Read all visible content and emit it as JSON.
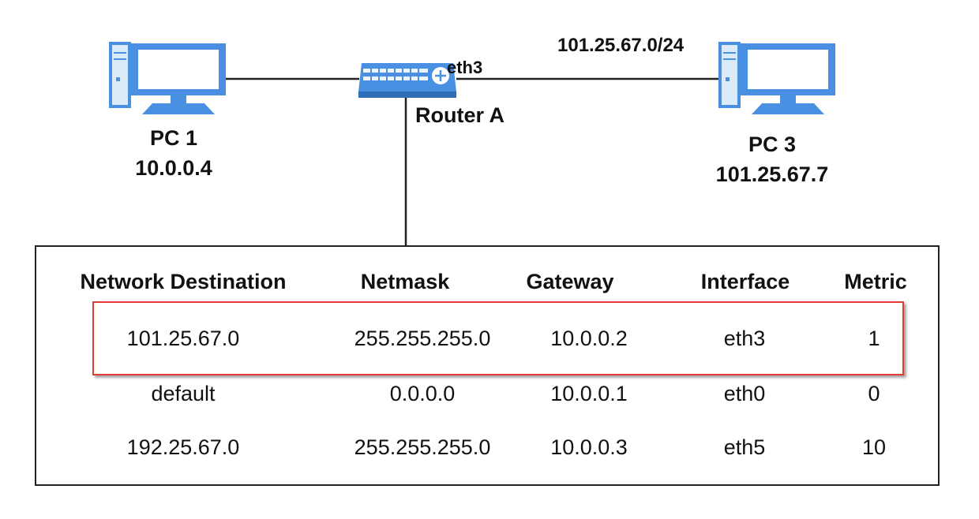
{
  "nodes": {
    "pc1": {
      "name": "PC 1",
      "ip": "10.0.0.4"
    },
    "pc3": {
      "name": "PC 3",
      "ip": "101.25.67.7"
    },
    "router": {
      "name": "Router A",
      "port_label": "eth3"
    }
  },
  "links": {
    "pc3_network": "101.25.67.0/24"
  },
  "routing_table": {
    "headers": [
      "Network Destination",
      "Netmask",
      "Gateway",
      "Interface",
      "Metric"
    ],
    "rows": [
      [
        "101.25.67.0",
        "255.255.255.0",
        "10.0.0.2",
        "eth3",
        "1"
      ],
      [
        "default",
        "0.0.0.0",
        "10.0.0.1",
        "eth0",
        "0"
      ],
      [
        "192.25.67.0",
        "255.255.255.0",
        "10.0.0.3",
        "eth5",
        "10"
      ]
    ],
    "highlighted_row": 0
  },
  "colors": {
    "device_blue": "#4a90e2",
    "device_light": "#dcebfa",
    "highlight_border": "#e53935"
  },
  "icons": {
    "pc": "desktop-computer-icon",
    "router": "router-icon"
  }
}
